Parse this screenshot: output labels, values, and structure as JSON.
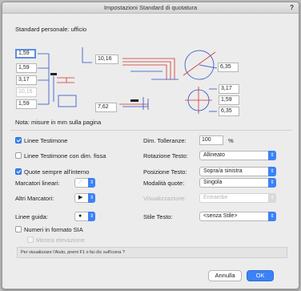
{
  "window": {
    "title": "Impostazioni Standard di quotatura",
    "help": "?"
  },
  "standard_label": "Standard personale: ufficio",
  "diagram": {
    "left_fields": [
      "1,59",
      "1,59",
      "3,17",
      "10,16",
      "1,59"
    ],
    "mid_top": "10,16",
    "mid_bottom": "7,62",
    "circle_top": "6,35",
    "circle_bottom": [
      "3,17",
      "1,59",
      "6,35"
    ]
  },
  "note": "Nota: misure in mm sulla pagina",
  "options": {
    "linee_testimone": {
      "label": "Linee Testimone",
      "checked": true
    },
    "linee_fissa": {
      "label": "Linee Testimone con dim. fissa",
      "checked": false
    },
    "quote_interno": {
      "label": "Quote sempre all'interno",
      "checked": true
    },
    "numeri_sia": {
      "label": "Numeri in formato SIA",
      "checked": false
    },
    "mostra_elevazione": {
      "label": "Mostra elevazione",
      "checked": false
    }
  },
  "markers": {
    "lineari_label": "Marcatori lineari:",
    "altri_label": "Altri Marcatori:",
    "guida_label": "Linee guida:",
    "lineari_icon": "slash-marker-icon",
    "altri_icon": "arrow-marker-icon",
    "guida_icon": "dot-marker-icon"
  },
  "right": {
    "tolleranze_label": "Dim. Tolleranze:",
    "tolleranze_value": "100",
    "tolleranze_unit": "%",
    "rotazione_label": "Rotazione Testo:",
    "rotazione_value": "Allineato",
    "posizione_label": "Posizione Testo:",
    "posizione_value": "Sopra/a sinistra",
    "modalita_label": "Modalità quote:",
    "modalita_value": "Singola",
    "visualizzazione_label": "Visualizzazione:",
    "visualizzazione_value": "Entrambe",
    "stile_label": "Stile Testo:",
    "stile_value": "<senza Stile>"
  },
  "help_text": "Per visualizzare l'Aiuto, premi F1 o fai clic sull'icona ?",
  "buttons": {
    "cancel": "Annulla",
    "ok": "OK"
  },
  "colors": {
    "accent": "#3b82f6",
    "diagram_red": "#d0312d",
    "diagram_blue": "#2b4fc4"
  }
}
